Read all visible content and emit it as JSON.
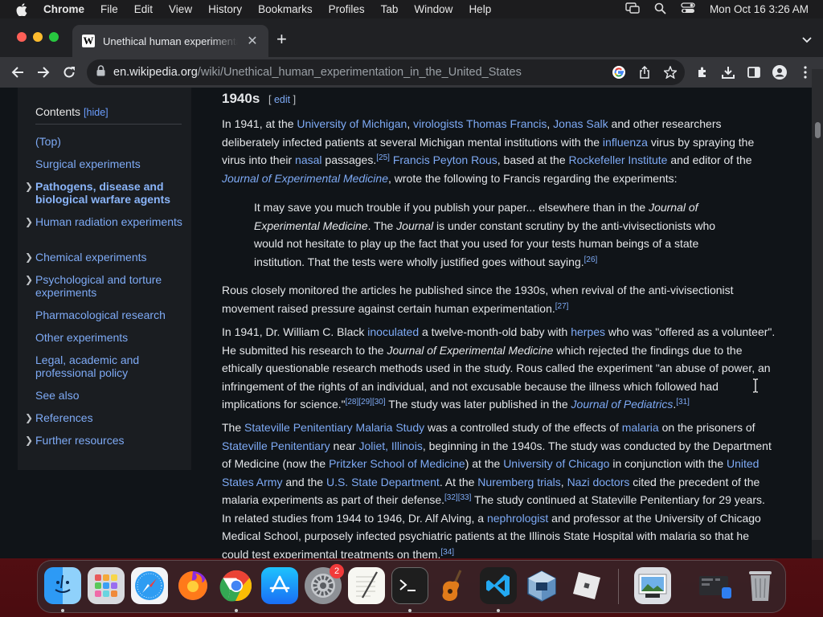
{
  "menubar": {
    "app": "Chrome",
    "items": [
      "File",
      "Edit",
      "View",
      "History",
      "Bookmarks",
      "Profiles",
      "Tab",
      "Window",
      "Help"
    ],
    "clock": "Mon Oct 16  3:26 AM"
  },
  "tab": {
    "title": "Unethical human experimentat",
    "favicon": "W"
  },
  "omnibox": {
    "host": "en.wikipedia.org",
    "path": "/wiki/Unethical_human_experimentation_in_the_United_States"
  },
  "toc": {
    "heading": "Contents",
    "hide_label": "[hide]",
    "items": [
      {
        "label": "(Top)",
        "bold": false,
        "chevron": false
      },
      {
        "label": "Surgical experiments",
        "bold": false,
        "chevron": false
      },
      {
        "label": "Pathogens, disease and biological warfare agents",
        "bold": true,
        "chevron": true
      },
      {
        "label": "Human radiation experiments",
        "bold": false,
        "chevron": true
      },
      {
        "label": "Chemical experiments",
        "bold": false,
        "chevron": true
      },
      {
        "label": "Psychological and torture experiments",
        "bold": false,
        "chevron": true
      },
      {
        "label": "Pharmacological research",
        "bold": false,
        "chevron": false
      },
      {
        "label": "Other experiments",
        "bold": false,
        "chevron": false
      },
      {
        "label": "Legal, academic and professional policy",
        "bold": false,
        "chevron": false
      },
      {
        "label": "See also",
        "bold": false,
        "chevron": false
      },
      {
        "label": "References",
        "bold": false,
        "chevron": true
      },
      {
        "label": "Further resources",
        "bold": false,
        "chevron": true
      }
    ]
  },
  "article": {
    "heading": "1940s",
    "edit_open": "[ ",
    "edit_label": "edit",
    "edit_close": " ]",
    "p1": {
      "s1": "In 1941, at the ",
      "l1": "University of Michigan",
      "s2": ", ",
      "l2": "virologists",
      "s3": " ",
      "l3": "Thomas Francis",
      "s4": ", ",
      "l4": "Jonas Salk",
      "s5": " and other researchers deliberately infected patients at several Michigan mental institutions with the ",
      "l5": "influenza",
      "s6": " virus by spraying the virus into their ",
      "l6": "nasal",
      "s7": " passages.",
      "ref1": "[25]",
      "s8": " ",
      "l7": "Francis Peyton Rous",
      "s9": ", based at the ",
      "l8": "Rockefeller Institute",
      "s10": " and editor of the ",
      "l9": "Journal of Experimental Medicine",
      "s11": ", wrote the following to Francis regarding the experiments:"
    },
    "quote": {
      "s1": "It may save you much trouble if you publish your paper... elsewhere than in the ",
      "i1": "Journal of Experimental Medicine",
      "s2": ". The ",
      "i2": "Journal",
      "s3": " is under constant scrutiny by the anti-vivisectionists who would not hesitate to play up the fact that you used for your tests human beings of a state institution. That the tests were wholly justified goes without saying.",
      "ref": "[26]"
    },
    "p2": {
      "text": "Rous closely monitored the articles he published since the 1930s, when revival of the anti-vivisectionist movement raised pressure against certain human experimentation.",
      "ref": "[27]"
    },
    "p3": {
      "s1": "In 1941, Dr. William C. Black ",
      "l1": "inoculated",
      "s2": " a twelve-month-old baby with ",
      "l2": "herpes",
      "s3": " who was \"offered as a volunteer\". He submitted his research to the ",
      "i1": "Journal of Experimental Medicine",
      "s4": " which rejected the findings due to the ethically questionable research methods used in the study. Rous called the experiment \"an abuse of power, an infringement of the rights of an individual, and not excusable because the illness which followed had implications for science.\"",
      "ref1": "[28][29][30]",
      "s5": " The study was later published in the ",
      "l3": "Journal of Pediatrics",
      "s6": ".",
      "ref2": "[31]"
    },
    "p4": {
      "s1": "The ",
      "l1": "Stateville Penitentiary Malaria Study",
      "s2": " was a controlled study of the effects of ",
      "l2": "malaria",
      "s3": " on the prisoners of ",
      "l3": "Stateville Penitentiary",
      "s4": " near ",
      "l4": "Joliet, Illinois",
      "s5": ", beginning in the 1940s. The study was conducted by the Department of Medicine (now the ",
      "l5": "Pritzker School of Medicine",
      "s6": ") at the ",
      "l6": "University of Chicago",
      "s7": " in conjunction with the ",
      "l7": "United States Army",
      "s8": " and the ",
      "l8": "U.S. State Department",
      "s9": ". At the ",
      "l9": "Nuremberg trials",
      "s10": ", ",
      "l10": "Nazi doctors",
      "s11": " cited the precedent of the malaria experiments as part of their defense.",
      "ref1": "[32][33]",
      "s12": " The study continued at Stateville Penitentiary for 29 years. In related studies from 1944 to 1946, Dr. Alf Alving, a ",
      "l11": "nephrologist",
      "s13": " and professor at the University of Chicago Medical School, purposely infected psychiatric patients at the Illinois State Hospital with malaria so that he could test experimental treatments on them.",
      "ref2": "[34]"
    }
  },
  "dock": {
    "settings_badge": "2"
  }
}
